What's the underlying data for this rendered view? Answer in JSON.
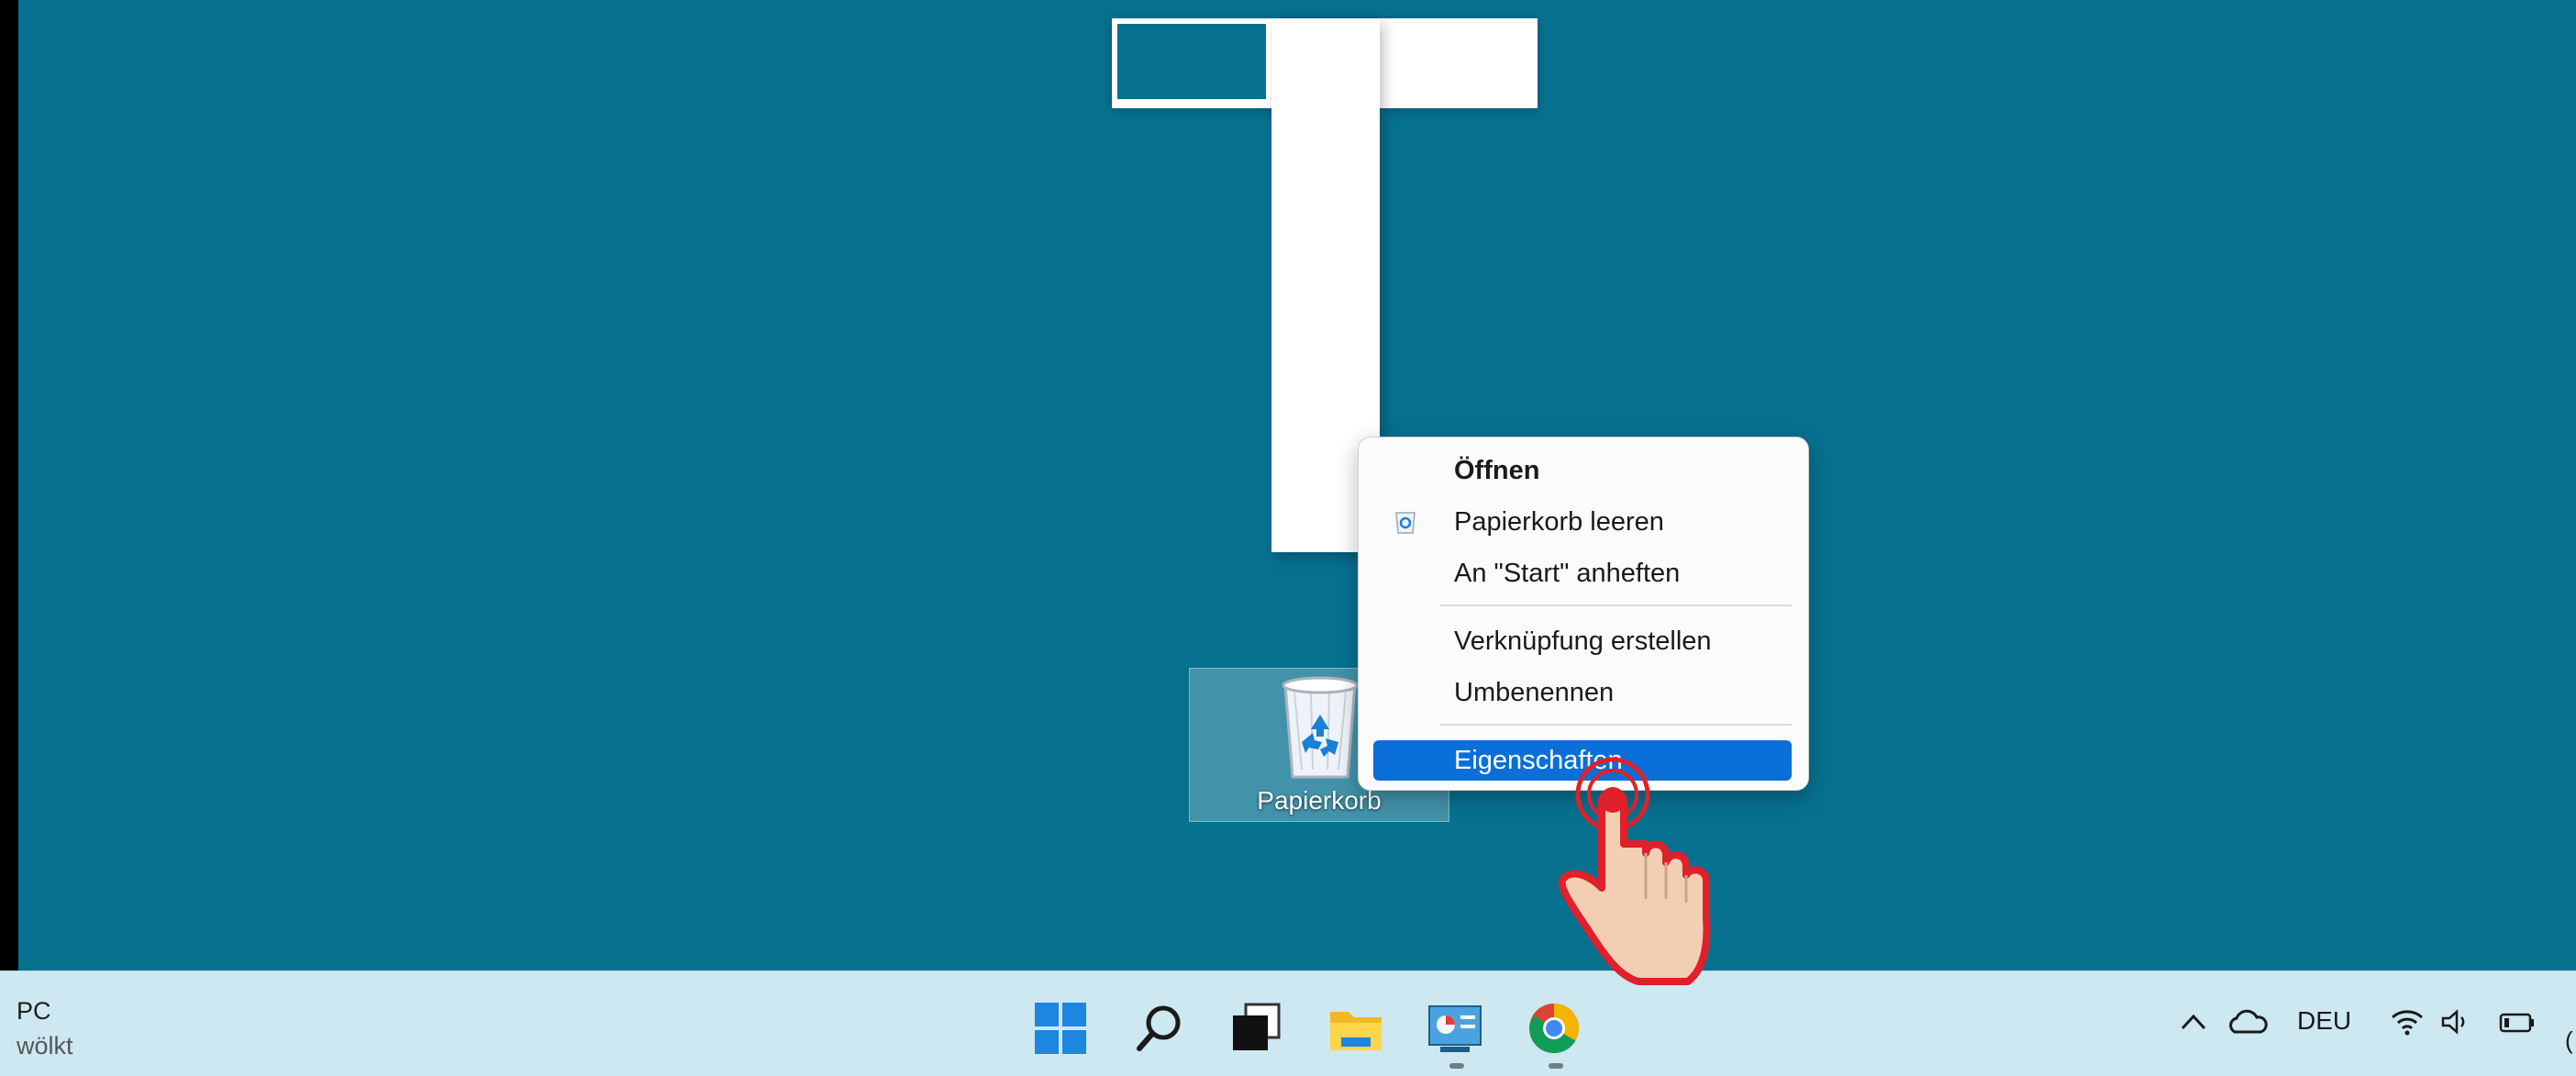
{
  "desktop": {
    "background": "#077190",
    "recycle_bin": {
      "label": "Papierkorb",
      "icon": "recycle-bin-icon"
    }
  },
  "context_menu": {
    "items": [
      {
        "label": "Öffnen",
        "bold": true
      },
      {
        "label": "Papierkorb leeren",
        "icon": "recycle-bin-small-icon"
      },
      {
        "label": "An \"Start\" anheften"
      },
      {
        "label": "Verknüpfung erstellen"
      },
      {
        "label": "Umbenennen"
      },
      {
        "label": "Eigenschaften",
        "highlighted": true
      }
    ],
    "highlight_color": "#0a6fd8"
  },
  "taskbar": {
    "weather_line1": "PC",
    "weather_line2": "wölkt",
    "apps": [
      "windows-start-icon",
      "search-icon",
      "task-view-icon",
      "file-explorer-icon",
      "control-panel-icon",
      "chrome-icon"
    ],
    "tray": {
      "language": "DEU",
      "clock_partial": "("
    }
  },
  "pointer": {
    "icon": "pointing-hand-icon",
    "accent": "#e0202a"
  }
}
